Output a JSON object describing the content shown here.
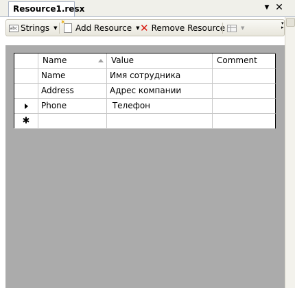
{
  "tab": {
    "title": "Resource1.resx",
    "pin_glyph": "▼",
    "close_glyph": "✕"
  },
  "toolbar": {
    "strings_label": "Strings",
    "strings_icon_text": "abc",
    "add_resource_label": "Add Resource",
    "remove_resource_label": "Remove Resource",
    "dropdown_glyph": "▼",
    "overflow_glyph": "▾▸"
  },
  "grid": {
    "columns": [
      "Name",
      "Value",
      "Comment"
    ],
    "rows": [
      {
        "marker": "",
        "name": "Name",
        "value": "Имя сотрудника",
        "comment": ""
      },
      {
        "marker": "",
        "name": "Address",
        "value": "Адрес компании",
        "comment": ""
      },
      {
        "marker": "current",
        "name": "Phone",
        "value": " Телефон",
        "comment": ""
      }
    ],
    "new_row_marker": "✱"
  }
}
